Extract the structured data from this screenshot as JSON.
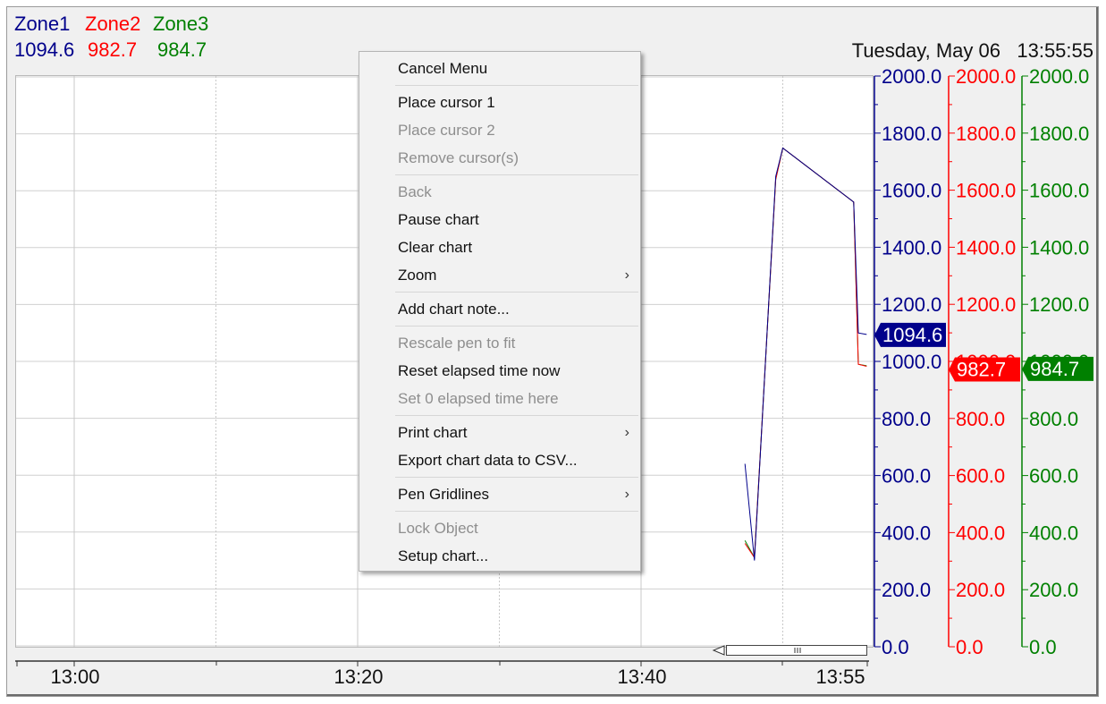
{
  "legend": [
    {
      "name": "Zone1",
      "value": "1094.6",
      "color": "#00008b"
    },
    {
      "name": "Zone2",
      "value": "982.7",
      "color": "#ff0000"
    },
    {
      "name": "Zone3",
      "value": "984.7",
      "color": "#008000"
    }
  ],
  "datetime": {
    "date": "Tuesday, May 06",
    "time": "13:55:55"
  },
  "axes": {
    "ticks": [
      "2000.0",
      "1800.0",
      "1600.0",
      "1400.0",
      "1200.0",
      "1000.0",
      "800.0",
      "600.0",
      "400.0",
      "200.0",
      "0.0"
    ],
    "zone1_tag": "1094.6",
    "zone2_tag": "982.7",
    "zone3_tag": "984.7"
  },
  "time_axis": {
    "labels": [
      "13:00",
      "13:20",
      "13:40",
      "13:55"
    ]
  },
  "menu": {
    "cancel": "Cancel Menu",
    "place_cursor_1": "Place cursor 1",
    "place_cursor_2": "Place cursor 2",
    "remove_cursors": "Remove cursor(s)",
    "back": "Back",
    "pause": "Pause chart",
    "clear": "Clear chart",
    "zoom": "Zoom",
    "add_note": "Add chart note...",
    "rescale": "Rescale pen to fit",
    "reset_elapsed": "Reset elapsed time now",
    "set_zero": "Set 0 elapsed time here",
    "print": "Print chart",
    "export": "Export chart data to CSV...",
    "pen_gridlines": "Pen Gridlines",
    "lock": "Lock Object",
    "setup": "Setup chart...",
    "submenu_arrow": "›"
  },
  "chart_data": {
    "type": "line",
    "ylim": [
      0,
      2000
    ],
    "x_unit": "time (HH:MM)",
    "series": [
      {
        "name": "Zone1",
        "color": "#00008b",
        "x": [
          "13:47:20",
          "13:48:00",
          "13:49:30",
          "13:50:00",
          "13:55:00",
          "13:55:20",
          "13:55:55"
        ],
        "y": [
          640,
          300,
          1650,
          1750,
          1560,
          1100,
          1094.6
        ]
      },
      {
        "name": "Zone2",
        "color": "#ff0000",
        "x": [
          "13:47:20",
          "13:48:00",
          "13:49:30",
          "13:50:00",
          "13:55:00",
          "13:55:20",
          "13:55:55"
        ],
        "y": [
          360,
          310,
          1640,
          1750,
          1560,
          990,
          982.7
        ]
      },
      {
        "name": "Zone3",
        "color": "#008000",
        "x": [
          "13:47:20",
          "13:48:00",
          "13:49:30",
          "13:50:00",
          "13:55:00",
          "13:55:20",
          "13:55:55"
        ],
        "y": [
          370,
          310,
          1640,
          1750,
          1560,
          990,
          984.7
        ]
      }
    ]
  }
}
